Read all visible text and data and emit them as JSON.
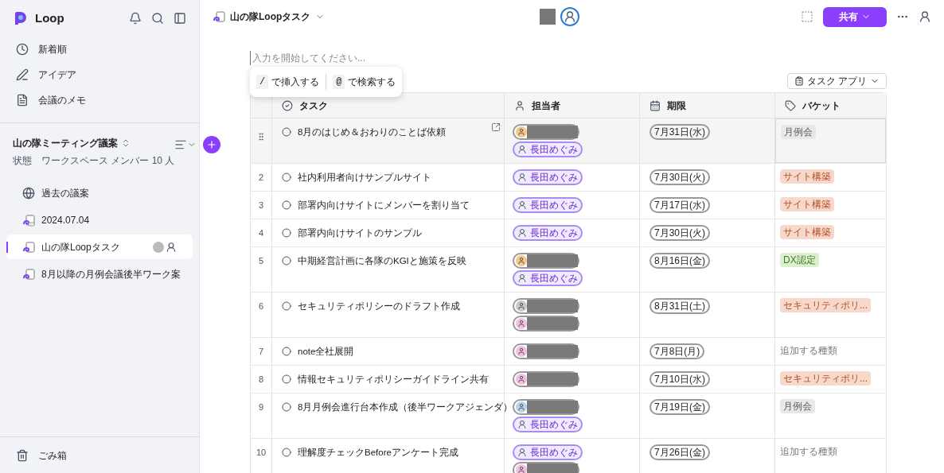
{
  "sidebar": {
    "app_name": "Loop",
    "nav": [
      {
        "label": "新着順"
      },
      {
        "label": "アイデア"
      },
      {
        "label": "会議のメモ"
      }
    ],
    "workspace": {
      "title": "山の隊ミーティング議案",
      "status": "状態",
      "members": "ワークスペース メンバー 10 人"
    },
    "pages": [
      {
        "label": "過去の議案",
        "kind": "globe",
        "selected": false
      },
      {
        "label": "2024.07.04",
        "kind": "loop-link",
        "selected": false
      },
      {
        "label": "山の隊Loopタスク",
        "kind": "loop",
        "selected": true
      },
      {
        "label": "8月以降の月例会議後半ワーク案",
        "kind": "loop",
        "selected": false
      }
    ],
    "trash": "ごみ箱"
  },
  "header": {
    "title": "山の隊Loopタスク",
    "share": "共有"
  },
  "editor": {
    "placeholder": "入力を開始してください...",
    "hints": [
      {
        "key": "/",
        "label": "で挿入する"
      },
      {
        "key": "@",
        "label": "で検索する"
      }
    ],
    "view": "タスク アプリ"
  },
  "table": {
    "columns": [
      {
        "label": "タスク"
      },
      {
        "label": "担当者"
      },
      {
        "label": "期限"
      },
      {
        "label": "バケット"
      }
    ],
    "rows": [
      {
        "selected": true,
        "task": "8月のはじめ＆おわりのことば依頼",
        "assignees": [
          {
            "kind": "redacted",
            "color": "#f5c98a"
          },
          {
            "kind": "named",
            "name": "長田めぐみ"
          }
        ],
        "due": "7月31日(水)",
        "bucket": {
          "kind": "tag",
          "label": "月例会",
          "color": "#e8e8e8"
        }
      },
      {
        "number": "2",
        "selected": false,
        "task": "社内利用者向けサンプルサイト",
        "assignees": [
          {
            "kind": "named",
            "name": "長田めぐみ"
          }
        ],
        "due": "7月30日(火)",
        "bucket": {
          "kind": "tag",
          "label": "サイト構築",
          "color": "#f6d9cc"
        }
      },
      {
        "number": "3",
        "selected": false,
        "task": "部署内向けサイトにメンバーを割り当て",
        "assignees": [
          {
            "kind": "named",
            "name": "長田めぐみ"
          }
        ],
        "due": "7月17日(水)",
        "bucket": {
          "kind": "tag",
          "label": "サイト構築",
          "color": "#f6d9cc"
        }
      },
      {
        "number": "4",
        "selected": false,
        "task": "部署内向けサイトのサンプル",
        "assignees": [
          {
            "kind": "named",
            "name": "長田めぐみ"
          }
        ],
        "due": "7月30日(火)",
        "bucket": {
          "kind": "tag",
          "label": "サイト構築",
          "color": "#f6d9cc"
        }
      },
      {
        "number": "5",
        "selected": false,
        "task": "中期経営計画に各隊のKGIと施策を反映",
        "assignees": [
          {
            "kind": "redacted",
            "color": "#f5c98a"
          },
          {
            "kind": "named",
            "name": "長田めぐみ"
          }
        ],
        "due": "8月16日(金)",
        "bucket": {
          "kind": "tag",
          "label": "DX認定",
          "color": "#dcefd0"
        }
      },
      {
        "number": "6",
        "selected": false,
        "task": "セキュリティポリシーのドラフト作成",
        "assignees": [
          {
            "kind": "redacted",
            "color": "#c8c8c8"
          },
          {
            "kind": "redacted",
            "color": "#f4c0e0"
          }
        ],
        "due": "8月31日(土)",
        "bucket": {
          "kind": "tag",
          "label": "セキュリティポリ...",
          "color": "#f6d9cc"
        }
      },
      {
        "number": "7",
        "selected": false,
        "task": "note全社展開",
        "assignees": [
          {
            "kind": "redacted",
            "color": "#f4c0e0"
          }
        ],
        "due": "7月8日(月)",
        "bucket": {
          "kind": "placeholder",
          "label": "追加する種類"
        }
      },
      {
        "number": "8",
        "selected": false,
        "task": "情報セキュリティポリシーガイドライン共有",
        "assignees": [
          {
            "kind": "redacted",
            "color": "#f4c0e0"
          }
        ],
        "due": "7月10日(水)",
        "bucket": {
          "kind": "tag",
          "label": "セキュリティポリ...",
          "color": "#f6d9cc"
        }
      },
      {
        "number": "9",
        "selected": false,
        "task": "8月月例会進行台本作成（後半ワークアジェンダ）",
        "assignees": [
          {
            "kind": "redacted",
            "color": "#b8d4ea"
          },
          {
            "kind": "named",
            "name": "長田めぐみ"
          }
        ],
        "due": "7月19日(金)",
        "bucket": {
          "kind": "tag",
          "label": "月例会",
          "color": "#e8e8e8"
        }
      },
      {
        "number": "10",
        "selected": false,
        "task": "理解度チェックBeforeアンケート完成",
        "assignees": [
          {
            "kind": "named",
            "name": "長田めぐみ"
          },
          {
            "kind": "redacted",
            "color": "#f4c0e0"
          }
        ],
        "due": "7月26日(金)",
        "bucket": {
          "kind": "placeholder",
          "label": "追加する種類"
        }
      }
    ]
  }
}
